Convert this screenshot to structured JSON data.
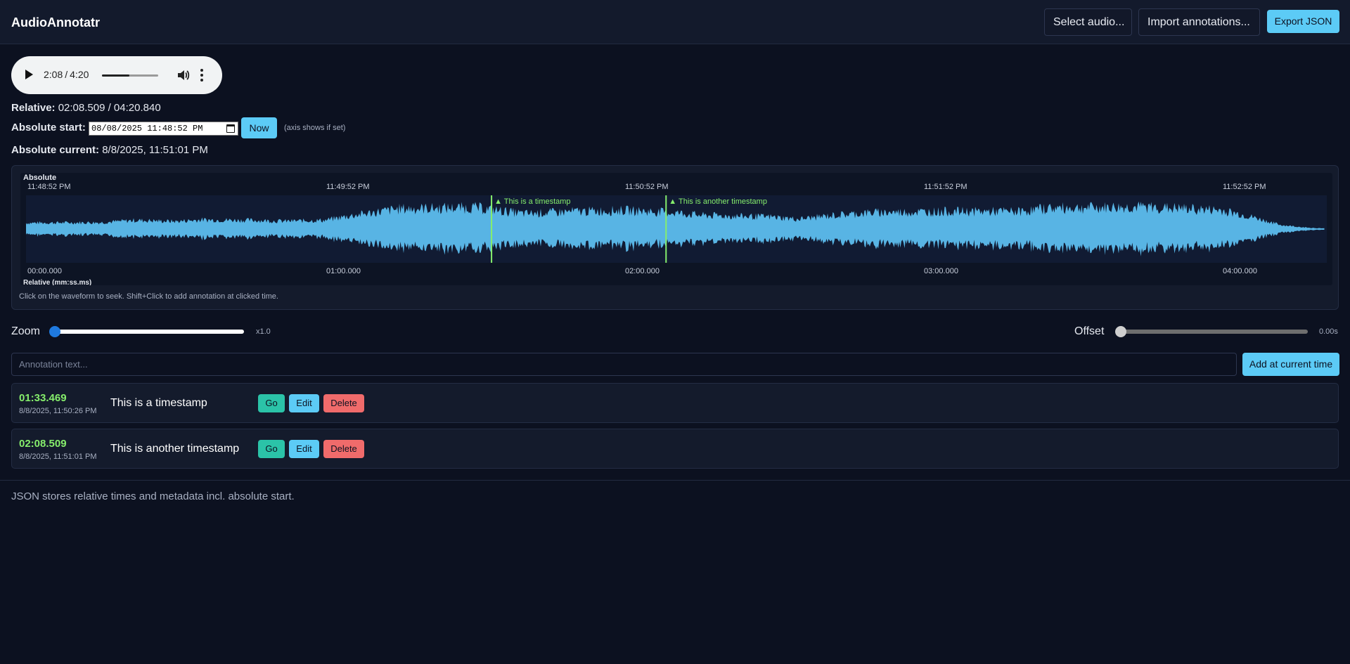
{
  "app": {
    "title": "AudioAnnotatr"
  },
  "toolbar": {
    "select_audio": "Select audio...",
    "import_annotations": "Import annotations...",
    "export_json": "Export JSON"
  },
  "player": {
    "current": "2:08",
    "separator": "/",
    "duration": "4:20",
    "progress": 0.49
  },
  "info": {
    "relative_label": "Relative:",
    "relative_value": "02:08.509 / 04:20.840",
    "absolute_start_label": "Absolute start:",
    "absolute_start_value": "08/08/2025 11:48:52 PM",
    "now_button": "Now",
    "axis_note": "(axis shows if set)",
    "absolute_current_label": "Absolute current:",
    "absolute_current_value": "8/8/2025, 11:51:01 PM"
  },
  "waveform": {
    "top_axis_title": "Absolute",
    "top_ticks": [
      "11:48:52 PM",
      "11:49:52 PM",
      "11:50:52 PM",
      "11:51:52 PM",
      "11:52:52 PM"
    ],
    "bottom_ticks": [
      "00:00.000",
      "01:00.000",
      "02:00.000",
      "03:00.000",
      "04:00.000"
    ],
    "bottom_axis_title": "Relative (mm:ss.ms)",
    "duration_s": 260.84,
    "markers": [
      {
        "time_s": 93.469,
        "label": "▲ This is a timestamp"
      },
      {
        "time_s": 128.509,
        "label": "▲ This is another timestamp"
      }
    ],
    "hint": "Click on the waveform to seek. Shift+Click to add annotation at clicked time.",
    "colors": {
      "wave": "#58b4e4",
      "marker": "#86ee6c",
      "bg": "#0d1424",
      "plot_bg": "#111b33"
    }
  },
  "controls": {
    "zoom_label": "Zoom",
    "zoom_value": "x1.0",
    "zoom_level": 0,
    "offset_label": "Offset",
    "offset_value": "0.00s",
    "offset_level": 0
  },
  "annotation_input": {
    "placeholder": "Annotation text...",
    "add_button": "Add at current time"
  },
  "annotations": [
    {
      "relative": "01:33.469",
      "absolute": "8/8/2025, 11:50:26 PM",
      "text": "This is a timestamp",
      "go": "Go",
      "edit": "Edit",
      "delete": "Delete"
    },
    {
      "relative": "02:08.509",
      "absolute": "8/8/2025, 11:51:01 PM",
      "text": "This is another timestamp",
      "go": "Go",
      "edit": "Edit",
      "delete": "Delete"
    }
  ],
  "footer": {
    "text": "JSON stores relative times and metadata incl. absolute start."
  }
}
